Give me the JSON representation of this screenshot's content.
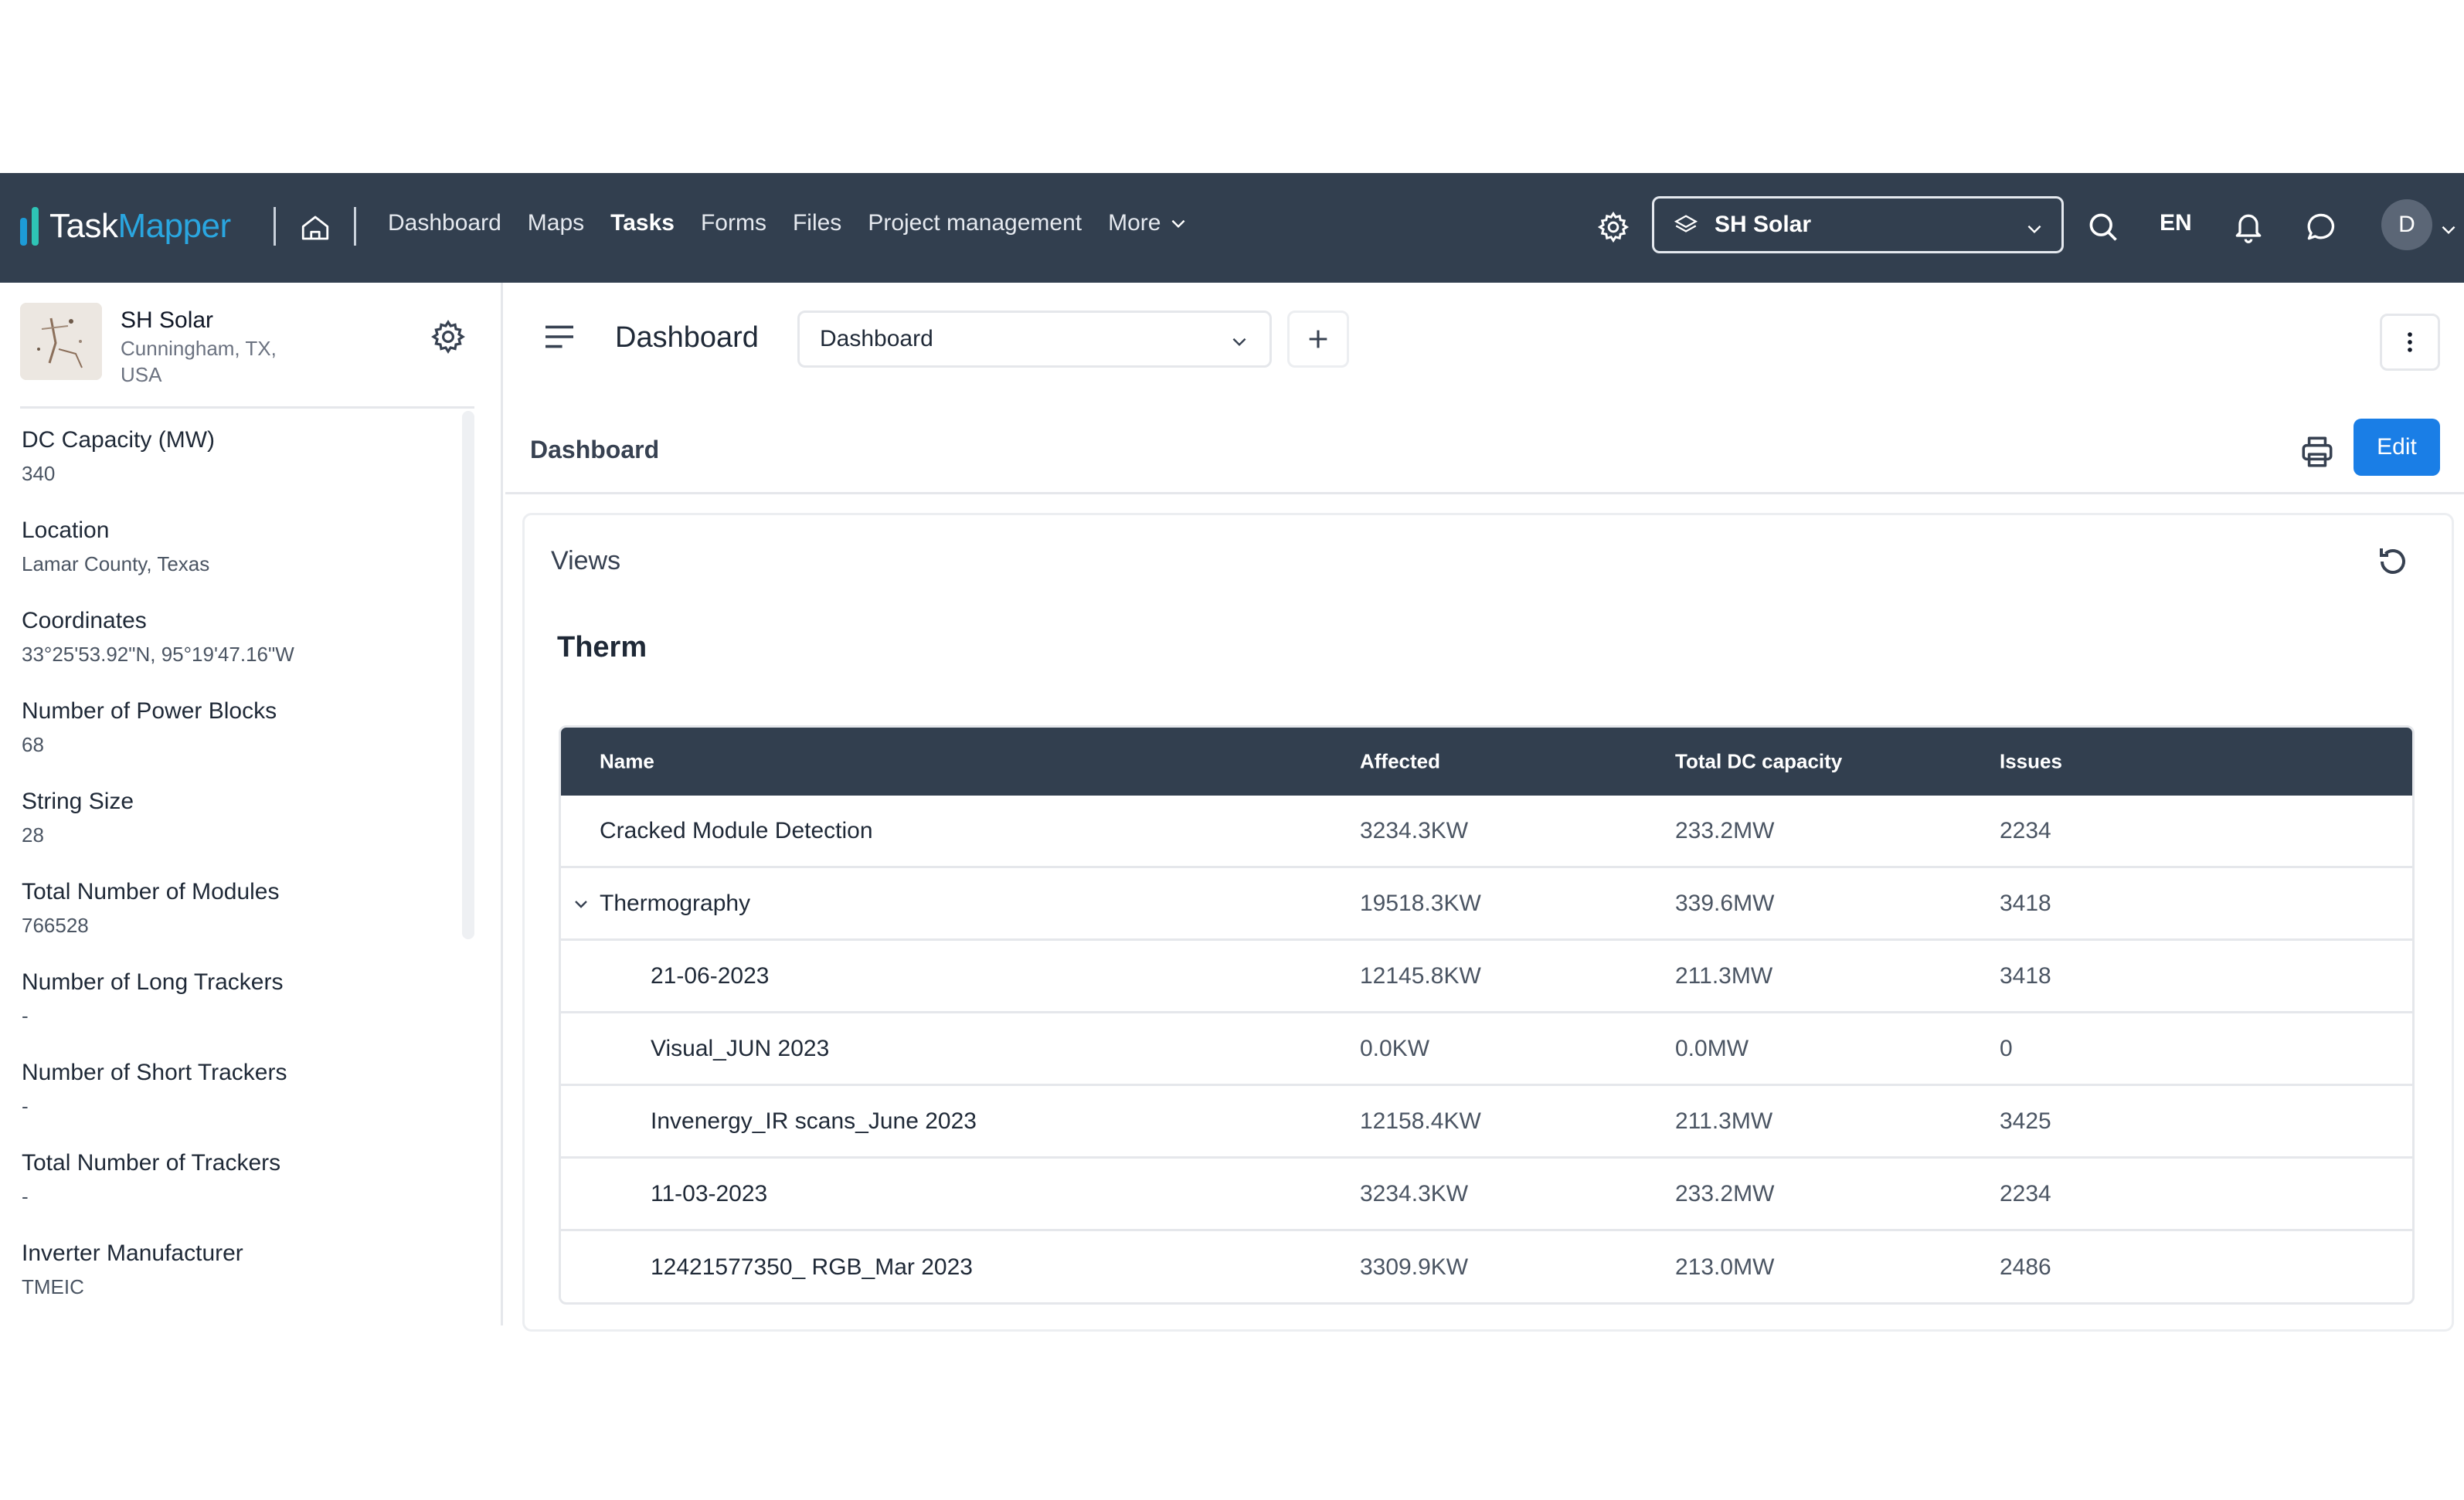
{
  "nav": {
    "logo_task": "Task",
    "logo_mapper": "Mapper",
    "links": [
      "Dashboard",
      "Maps",
      "Tasks",
      "Forms",
      "Files",
      "Project management"
    ],
    "active": "Tasks",
    "more_label": "More",
    "org_select": "SH Solar",
    "lang": "EN",
    "avatar_initial": "D"
  },
  "sidebar": {
    "site_name": "SH Solar",
    "site_address": "Cunningham, TX, USA",
    "properties": [
      {
        "label": "DC Capacity (MW)",
        "value": "340"
      },
      {
        "label": "Location",
        "value": "Lamar County, Texas"
      },
      {
        "label": "Coordinates",
        "value": "33°25'53.92\"N, 95°19'47.16\"W"
      },
      {
        "label": "Number of Power Blocks",
        "value": "68"
      },
      {
        "label": "String Size",
        "value": "28"
      },
      {
        "label": "Total Number of Modules",
        "value": "766528"
      },
      {
        "label": "Number of Long Trackers",
        "value": "-"
      },
      {
        "label": "Number of Short Trackers",
        "value": "-"
      },
      {
        "label": "Total Number of Trackers",
        "value": "-"
      },
      {
        "label": "Inverter Manufacturer",
        "value": "TMEIC"
      }
    ]
  },
  "main": {
    "page_title": "Dashboard",
    "dashboard_select": "Dashboard",
    "sub_title": "Dashboard",
    "edit_label": "Edit",
    "views_title": "Views",
    "section_title": "Therm",
    "table": {
      "headers": [
        "Name",
        "Affected",
        "Total DC capacity",
        "Issues"
      ],
      "rows": [
        {
          "name": "Cracked Module Detection",
          "affected": "3234.3KW",
          "dc": "233.2MW",
          "issues": "2234"
        },
        {
          "name": "Thermography",
          "affected": "19518.3KW",
          "dc": "339.6MW",
          "issues": "3418"
        },
        {
          "name": "21-06-2023",
          "affected": "12145.8KW",
          "dc": "211.3MW",
          "issues": "3418"
        },
        {
          "name": "Visual_JUN 2023",
          "affected": "0.0KW",
          "dc": "0.0MW",
          "issues": "0"
        },
        {
          "name": "Invenergy_IR scans_June 2023",
          "affected": "12158.4KW",
          "dc": "211.3MW",
          "issues": "3425"
        },
        {
          "name": "11-03-2023",
          "affected": "3234.3KW",
          "dc": "233.2MW",
          "issues": "2234"
        },
        {
          "name": "12421577350_ RGB_Mar 2023",
          "affected": "3309.9KW",
          "dc": "213.0MW",
          "issues": "2486"
        }
      ]
    }
  },
  "colors": {
    "nav_bg": "#323f4f",
    "accent": "#1a7ee6",
    "logo_blue": "#2aa6e0",
    "logo_teal": "#2ec4b6"
  }
}
